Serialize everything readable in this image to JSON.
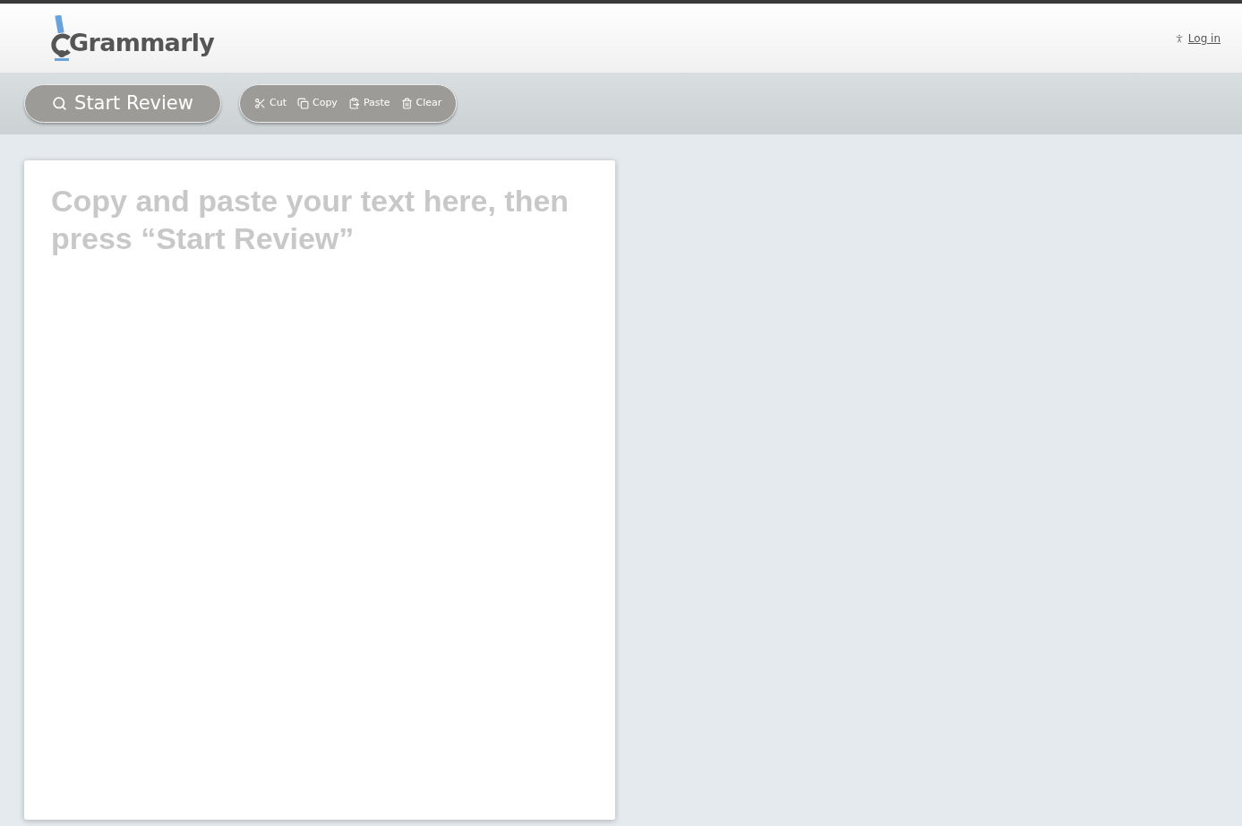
{
  "header": {
    "logo": "Grammarly",
    "login_link": "Log in"
  },
  "toolbar": {
    "start_review": {
      "label": "Start Review",
      "disabled": true
    },
    "actions": [
      {
        "kind": "cut",
        "label": "Cut",
        "disabled": true
      },
      {
        "kind": "copy",
        "label": "Copy",
        "disabled": true
      },
      {
        "kind": "paste",
        "label": "Paste",
        "disabled": true
      },
      {
        "kind": "clear",
        "label": "Clear",
        "disabled": true
      }
    ]
  },
  "editor": {
    "placeholder": "Copy and paste your text here, then press “Start Review”"
  }
}
